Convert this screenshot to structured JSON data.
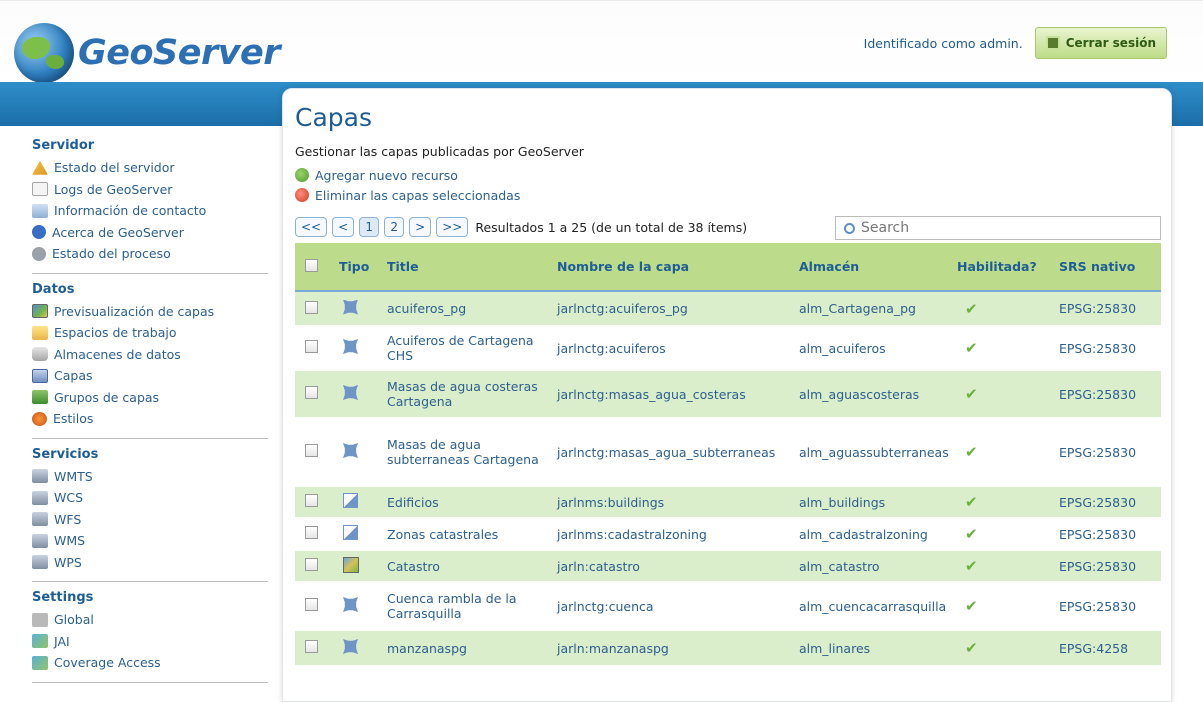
{
  "header": {
    "logo_text": "GeoServer",
    "user_text": "Identificado como admin.",
    "logout_label": "Cerrar sesión"
  },
  "sidebar": {
    "sections": [
      {
        "title": "Servidor",
        "items": [
          {
            "label": "Estado del servidor",
            "icon": "warning-icon"
          },
          {
            "label": "Logs de GeoServer",
            "icon": "document-icon"
          },
          {
            "label": "Información de contacto",
            "icon": "contact-card-icon"
          },
          {
            "label": "Acerca de GeoServer",
            "icon": "info-icon"
          },
          {
            "label": "Estado del proceso",
            "icon": "gear-icon"
          }
        ]
      },
      {
        "title": "Datos",
        "items": [
          {
            "label": "Previsualización de capas",
            "icon": "map-preview-icon"
          },
          {
            "label": "Espacios de trabajo",
            "icon": "folder-icon"
          },
          {
            "label": "Almacenes de datos",
            "icon": "database-icon"
          },
          {
            "label": "Capas",
            "icon": "layer-icon"
          },
          {
            "label": "Grupos de capas",
            "icon": "layer-group-icon"
          },
          {
            "label": "Estilos",
            "icon": "style-palette-icon"
          }
        ]
      },
      {
        "title": "Servicios",
        "items": [
          {
            "label": "WMTS",
            "icon": "service-icon"
          },
          {
            "label": "WCS",
            "icon": "service-icon"
          },
          {
            "label": "WFS",
            "icon": "service-icon"
          },
          {
            "label": "WMS",
            "icon": "service-icon"
          },
          {
            "label": "WPS",
            "icon": "service-icon"
          }
        ]
      },
      {
        "title": "Settings",
        "items": [
          {
            "label": "Global",
            "icon": "global-settings-icon"
          },
          {
            "label": "JAI",
            "icon": "jai-icon"
          },
          {
            "label": "Coverage Access",
            "icon": "coverage-icon"
          }
        ]
      }
    ]
  },
  "main": {
    "title": "Capas",
    "description": "Gestionar las capas publicadas por GeoServer",
    "add_label": "Agregar nuevo recurso",
    "remove_label": "Eliminar las capas seleccionadas",
    "pager": {
      "first": "<<",
      "prev": "<",
      "page1": "1",
      "page2": "2",
      "next": ">",
      "last": ">>",
      "summary": "Resultados 1 a 25 (de un total de 38 ítems)"
    },
    "search_placeholder": "Search",
    "columns": [
      "Tipo",
      "Title",
      "Nombre de la capa",
      "Almacén",
      "Habilitada?",
      "SRS nativo"
    ],
    "rows": [
      {
        "type": "polygon",
        "title": "acuiferos_pg",
        "name": "jarlnctg:acuiferos_pg",
        "store": "alm_Cartagena_pg",
        "enabled": "✔",
        "srs": "EPSG:25830"
      },
      {
        "type": "polygon",
        "title": "Acuiferos de Cartagena CHS",
        "name": "jarlnctg:acuiferos",
        "store": "alm_acuiferos",
        "enabled": "✔",
        "srs": "EPSG:25830"
      },
      {
        "type": "polygon",
        "title": "Masas de agua costeras Cartagena",
        "name": "jarlnctg:masas_agua_costeras",
        "store": "alm_aguascosteras",
        "enabled": "✔",
        "srs": "EPSG:25830"
      },
      {
        "type": "polygon",
        "title": "Masas de agua subterraneas Cartagena",
        "name": "jarlnctg:masas_agua_subterraneas",
        "store": "alm_aguassubterraneas",
        "enabled": "✔",
        "srs": "EPSG:25830"
      },
      {
        "type": "vector",
        "title": "Edificios",
        "name": "jarlnms:buildings",
        "store": "alm_buildings",
        "enabled": "✔",
        "srs": "EPSG:25830"
      },
      {
        "type": "vector",
        "title": "Zonas catastrales",
        "name": "jarlnms:cadastralzoning",
        "store": "alm_cadastralzoning",
        "enabled": "✔",
        "srs": "EPSG:25830"
      },
      {
        "type": "raster",
        "title": "Catastro",
        "name": "jarln:catastro",
        "store": "alm_catastro",
        "enabled": "✔",
        "srs": "EPSG:25830"
      },
      {
        "type": "polygon",
        "title": "Cuenca rambla de la Carrasquilla",
        "name": "jarlnctg:cuenca",
        "store": "alm_cuencacarrasquilla",
        "enabled": "✔",
        "srs": "EPSG:25830"
      },
      {
        "type": "polygon",
        "title": "manzanaspg",
        "name": "jarln:manzanaspg",
        "store": "alm_linares",
        "enabled": "✔",
        "srs": "EPSG:4258"
      }
    ]
  }
}
